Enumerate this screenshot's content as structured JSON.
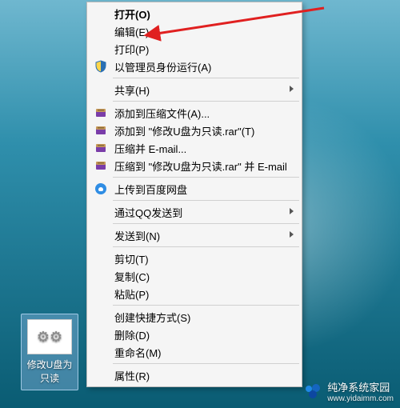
{
  "desktop_icon": {
    "label": "修改U盘为只读",
    "glyph": "⚙⚙"
  },
  "menu": {
    "open": "打开(O)",
    "edit": "编辑(E)",
    "print": "打印(P)",
    "run_admin": "以管理员身份运行(A)",
    "share": "共享(H)",
    "rar_add": "添加到压缩文件(A)...",
    "rar_add_to": "添加到 \"修改U盘为只读.rar\"(T)",
    "rar_email": "压缩并 E-mail...",
    "rar_email_to": "压缩到 \"修改U盘为只读.rar\" 并 E-mail",
    "baidu": "上传到百度网盘",
    "qq": "通过QQ发送到",
    "send_to": "发送到(N)",
    "cut": "剪切(T)",
    "copy": "复制(C)",
    "paste": "粘贴(P)",
    "shortcut": "创建快捷方式(S)",
    "delete": "删除(D)",
    "rename": "重命名(M)",
    "properties": "属性(R)"
  },
  "annotation": {
    "target": "edit"
  },
  "watermark": {
    "title": "纯净系统家园",
    "url": "www.yidaimm.com"
  }
}
